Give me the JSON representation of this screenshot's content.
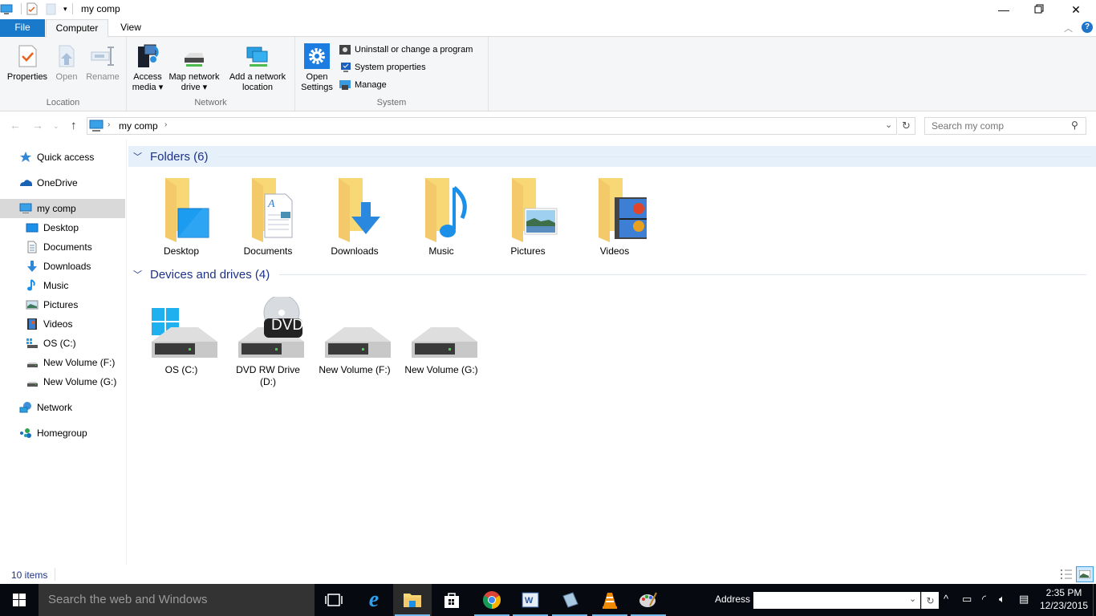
{
  "window": {
    "title": "my comp",
    "controls": {
      "minimize": "minimize-icon",
      "maximize": "restore-icon",
      "close": "close-icon"
    }
  },
  "tabs": [
    {
      "label": "File",
      "active": false
    },
    {
      "label": "Computer",
      "active": true
    },
    {
      "label": "View",
      "active": false
    }
  ],
  "ribbon": {
    "groups": [
      {
        "label": "Location",
        "buttons": [
          {
            "label": "Properties",
            "icon": "properties-icon",
            "enabled": true
          },
          {
            "label": "Open",
            "icon": "open-icon",
            "enabled": false
          },
          {
            "label": "Rename",
            "icon": "rename-icon",
            "enabled": false
          }
        ]
      },
      {
        "label": "Network",
        "buttons": [
          {
            "label_line1": "Access",
            "label_line2": "media ▾",
            "icon": "access-media-icon"
          },
          {
            "label_line1": "Map network",
            "label_line2": "drive ▾",
            "icon": "map-network-drive-icon"
          },
          {
            "label_line1": "Add a network",
            "label_line2": "location",
            "icon": "add-network-location-icon"
          }
        ]
      },
      {
        "label": "System",
        "big_button": {
          "label_line1": "Open",
          "label_line2": "Settings",
          "icon": "settings-gear-icon"
        },
        "small_buttons": [
          {
            "label": "Uninstall or change a program",
            "icon": "uninstall-icon"
          },
          {
            "label": "System properties",
            "icon": "system-properties-icon"
          },
          {
            "label": "Manage",
            "icon": "manage-icon"
          }
        ]
      }
    ]
  },
  "navigation": {
    "breadcrumb": [
      "my comp"
    ],
    "search_placeholder": "Search my comp"
  },
  "sidebar": {
    "items": [
      {
        "label": "Quick access",
        "icon": "star-icon",
        "level": 0
      },
      {
        "label": "OneDrive",
        "icon": "cloud-icon",
        "level": 0
      },
      {
        "label": "my comp",
        "icon": "computer-icon",
        "level": 0,
        "selected": true
      },
      {
        "label": "Desktop",
        "icon": "desktop-icon",
        "level": 1
      },
      {
        "label": "Documents",
        "icon": "documents-icon",
        "level": 1
      },
      {
        "label": "Downloads",
        "icon": "downloads-icon",
        "level": 1
      },
      {
        "label": "Music",
        "icon": "music-icon",
        "level": 1
      },
      {
        "label": "Pictures",
        "icon": "pictures-icon",
        "level": 1
      },
      {
        "label": "Videos",
        "icon": "videos-icon",
        "level": 1
      },
      {
        "label": "OS (C:)",
        "icon": "os-drive-icon",
        "level": 1
      },
      {
        "label": "New Volume (F:)",
        "icon": "drive-icon",
        "level": 1
      },
      {
        "label": "New Volume (G:)",
        "icon": "drive-icon",
        "level": 1
      },
      {
        "label": "Network",
        "icon": "network-icon",
        "level": 0
      },
      {
        "label": "Homegroup",
        "icon": "homegroup-icon",
        "level": 0
      }
    ]
  },
  "content": {
    "folders_header": "Folders (6)",
    "folders": [
      {
        "label": "Desktop",
        "overlay": "desktop"
      },
      {
        "label": "Documents",
        "overlay": "document"
      },
      {
        "label": "Downloads",
        "overlay": "download-arrow"
      },
      {
        "label": "Music",
        "overlay": "music-note"
      },
      {
        "label": "Pictures",
        "overlay": "picture"
      },
      {
        "label": "Videos",
        "overlay": "filmstrip"
      }
    ],
    "drives_header": "Devices and drives (4)",
    "drives": [
      {
        "label": "OS (C:)",
        "type": "os"
      },
      {
        "label_line1": "DVD RW Drive",
        "label_line2": "(D:)",
        "type": "dvd",
        "badge": "DVD"
      },
      {
        "label": "New Volume (F:)",
        "type": "hdd"
      },
      {
        "label": "New Volume (G:)",
        "type": "hdd"
      }
    ]
  },
  "status": {
    "item_count": "10 items"
  },
  "taskbar": {
    "search_placeholder": "Search the web and Windows",
    "apps": [
      {
        "name": "task-view",
        "active": false
      },
      {
        "name": "internet-explorer",
        "active": false
      },
      {
        "name": "file-explorer",
        "active": true
      },
      {
        "name": "store",
        "active": false
      },
      {
        "name": "chrome",
        "active": false
      },
      {
        "name": "word",
        "active": false
      },
      {
        "name": "notepad",
        "active": false
      },
      {
        "name": "vlc",
        "active": false
      },
      {
        "name": "paint",
        "active": false
      }
    ],
    "address_label": "Address",
    "address_value": "",
    "time": "2:35 PM",
    "date": "12/23/2015"
  },
  "colors": {
    "accent": "#1979ca",
    "group_header_text": "#1e3287",
    "folder_yellow": "#f8d775",
    "taskbar_bg": "#060a10",
    "selected_nav": "#d9d9d9"
  }
}
